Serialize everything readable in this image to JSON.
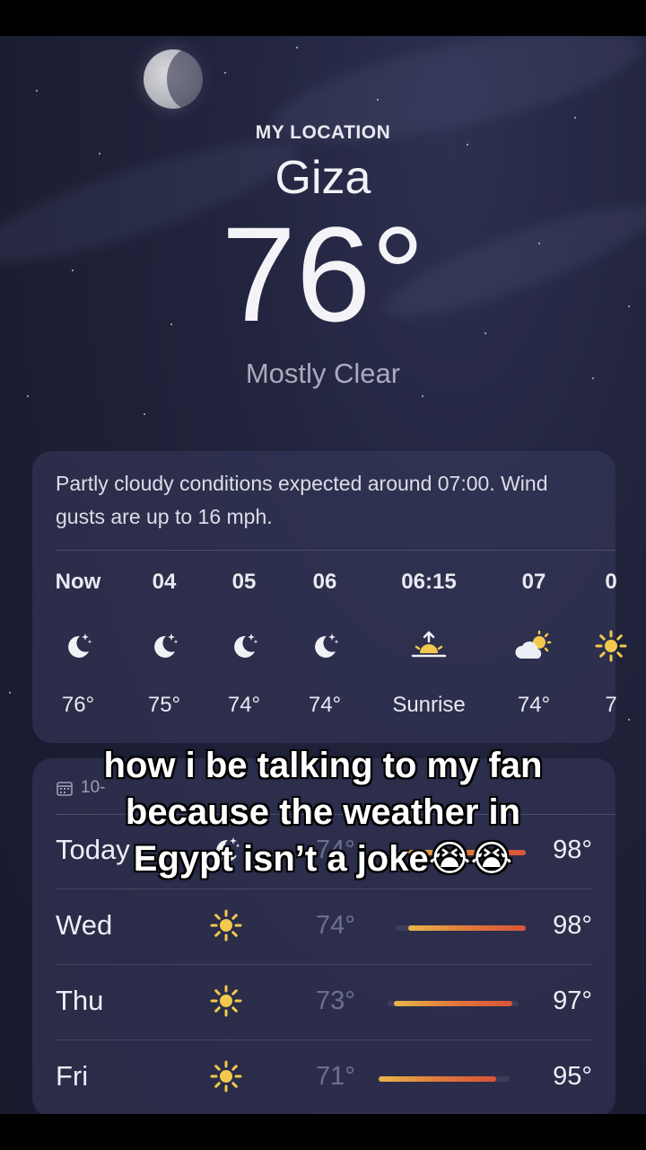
{
  "header": {
    "location_label": "MY LOCATION",
    "city": "Giza",
    "temperature": "76°",
    "condition": "Mostly Clear"
  },
  "hourly": {
    "summary": "Partly cloudy conditions expected around 07:00. Wind gusts are up to 16 mph.",
    "items": [
      {
        "label": "Now",
        "icon": "moon-stars-icon",
        "temp": "76°"
      },
      {
        "label": "04",
        "icon": "moon-stars-icon",
        "temp": "75°"
      },
      {
        "label": "05",
        "icon": "moon-stars-icon",
        "temp": "74°"
      },
      {
        "label": "06",
        "icon": "moon-stars-icon",
        "temp": "74°"
      },
      {
        "label": "06:15",
        "icon": "sunrise-icon",
        "temp": "Sunrise"
      },
      {
        "label": "07",
        "icon": "partly-cloudy-icon",
        "temp": "74°"
      },
      {
        "label": "0",
        "icon": "sun-icon",
        "temp": "7"
      }
    ]
  },
  "daily": {
    "header": "10-",
    "rows": [
      {
        "day": "Today",
        "icon": "moon-stars-icon",
        "low": "74°",
        "high": "98°",
        "bar_start": 0.1,
        "bar_end": 1.0
      },
      {
        "day": "Wed",
        "icon": "sun-icon",
        "low": "74°",
        "high": "98°",
        "bar_start": 0.1,
        "bar_end": 1.0
      },
      {
        "day": "Thu",
        "icon": "sun-icon",
        "low": "73°",
        "high": "97°",
        "bar_start": 0.05,
        "bar_end": 0.95
      },
      {
        "day": "Fri",
        "icon": "sun-icon",
        "low": "71°",
        "high": "95°",
        "bar_start": 0.0,
        "bar_end": 0.9
      }
    ]
  },
  "overlay": {
    "caption_line1": "how i be talking to my fan",
    "caption_line2": "because the weather in",
    "caption_line3": "Egypt isn’t a joke😭😭"
  },
  "colors": {
    "background": "#1b1d33",
    "card": "#383b5c",
    "sun": "#f2c94c",
    "bar_start": "#e9b64a",
    "bar_end": "#d9533a"
  }
}
